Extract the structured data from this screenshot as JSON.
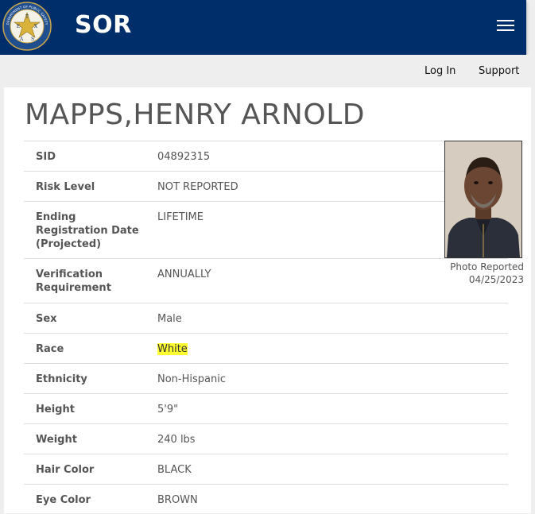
{
  "header": {
    "brand": "SOR",
    "seal_text": [
      "E",
      "X",
      "A",
      "S",
      "T"
    ],
    "seal_ring_text": "DEPARTMENT OF PUBLIC SAFETY"
  },
  "nav": {
    "login": "Log In",
    "support": "Support"
  },
  "record": {
    "name": "MAPPS,HENRY ARNOLD",
    "rows": [
      {
        "label": "SID",
        "value": "04892315"
      },
      {
        "label": "Risk Level",
        "value": "NOT REPORTED"
      },
      {
        "label": "Ending Registration Date (Projected)",
        "value": "LIFETIME"
      },
      {
        "label": "Verification Requirement",
        "value": "ANNUALLY"
      },
      {
        "label": "Sex",
        "value": "Male"
      },
      {
        "label": "Race",
        "value": "White"
      },
      {
        "label": "Ethnicity",
        "value": "Non-Hispanic"
      },
      {
        "label": "Height",
        "value": "5'9\""
      },
      {
        "label": "Weight",
        "value": "240 lbs"
      },
      {
        "label": "Hair Color",
        "value": "BLACK"
      },
      {
        "label": "Eye Color",
        "value": "BROWN"
      }
    ],
    "highlighted_field": "Race"
  },
  "photo": {
    "caption_line1": "Photo Reported",
    "caption_line2": "04/25/2023"
  },
  "colors": {
    "header_bg": "#002e6a",
    "highlight": "#ffff33",
    "text": "#555555"
  }
}
